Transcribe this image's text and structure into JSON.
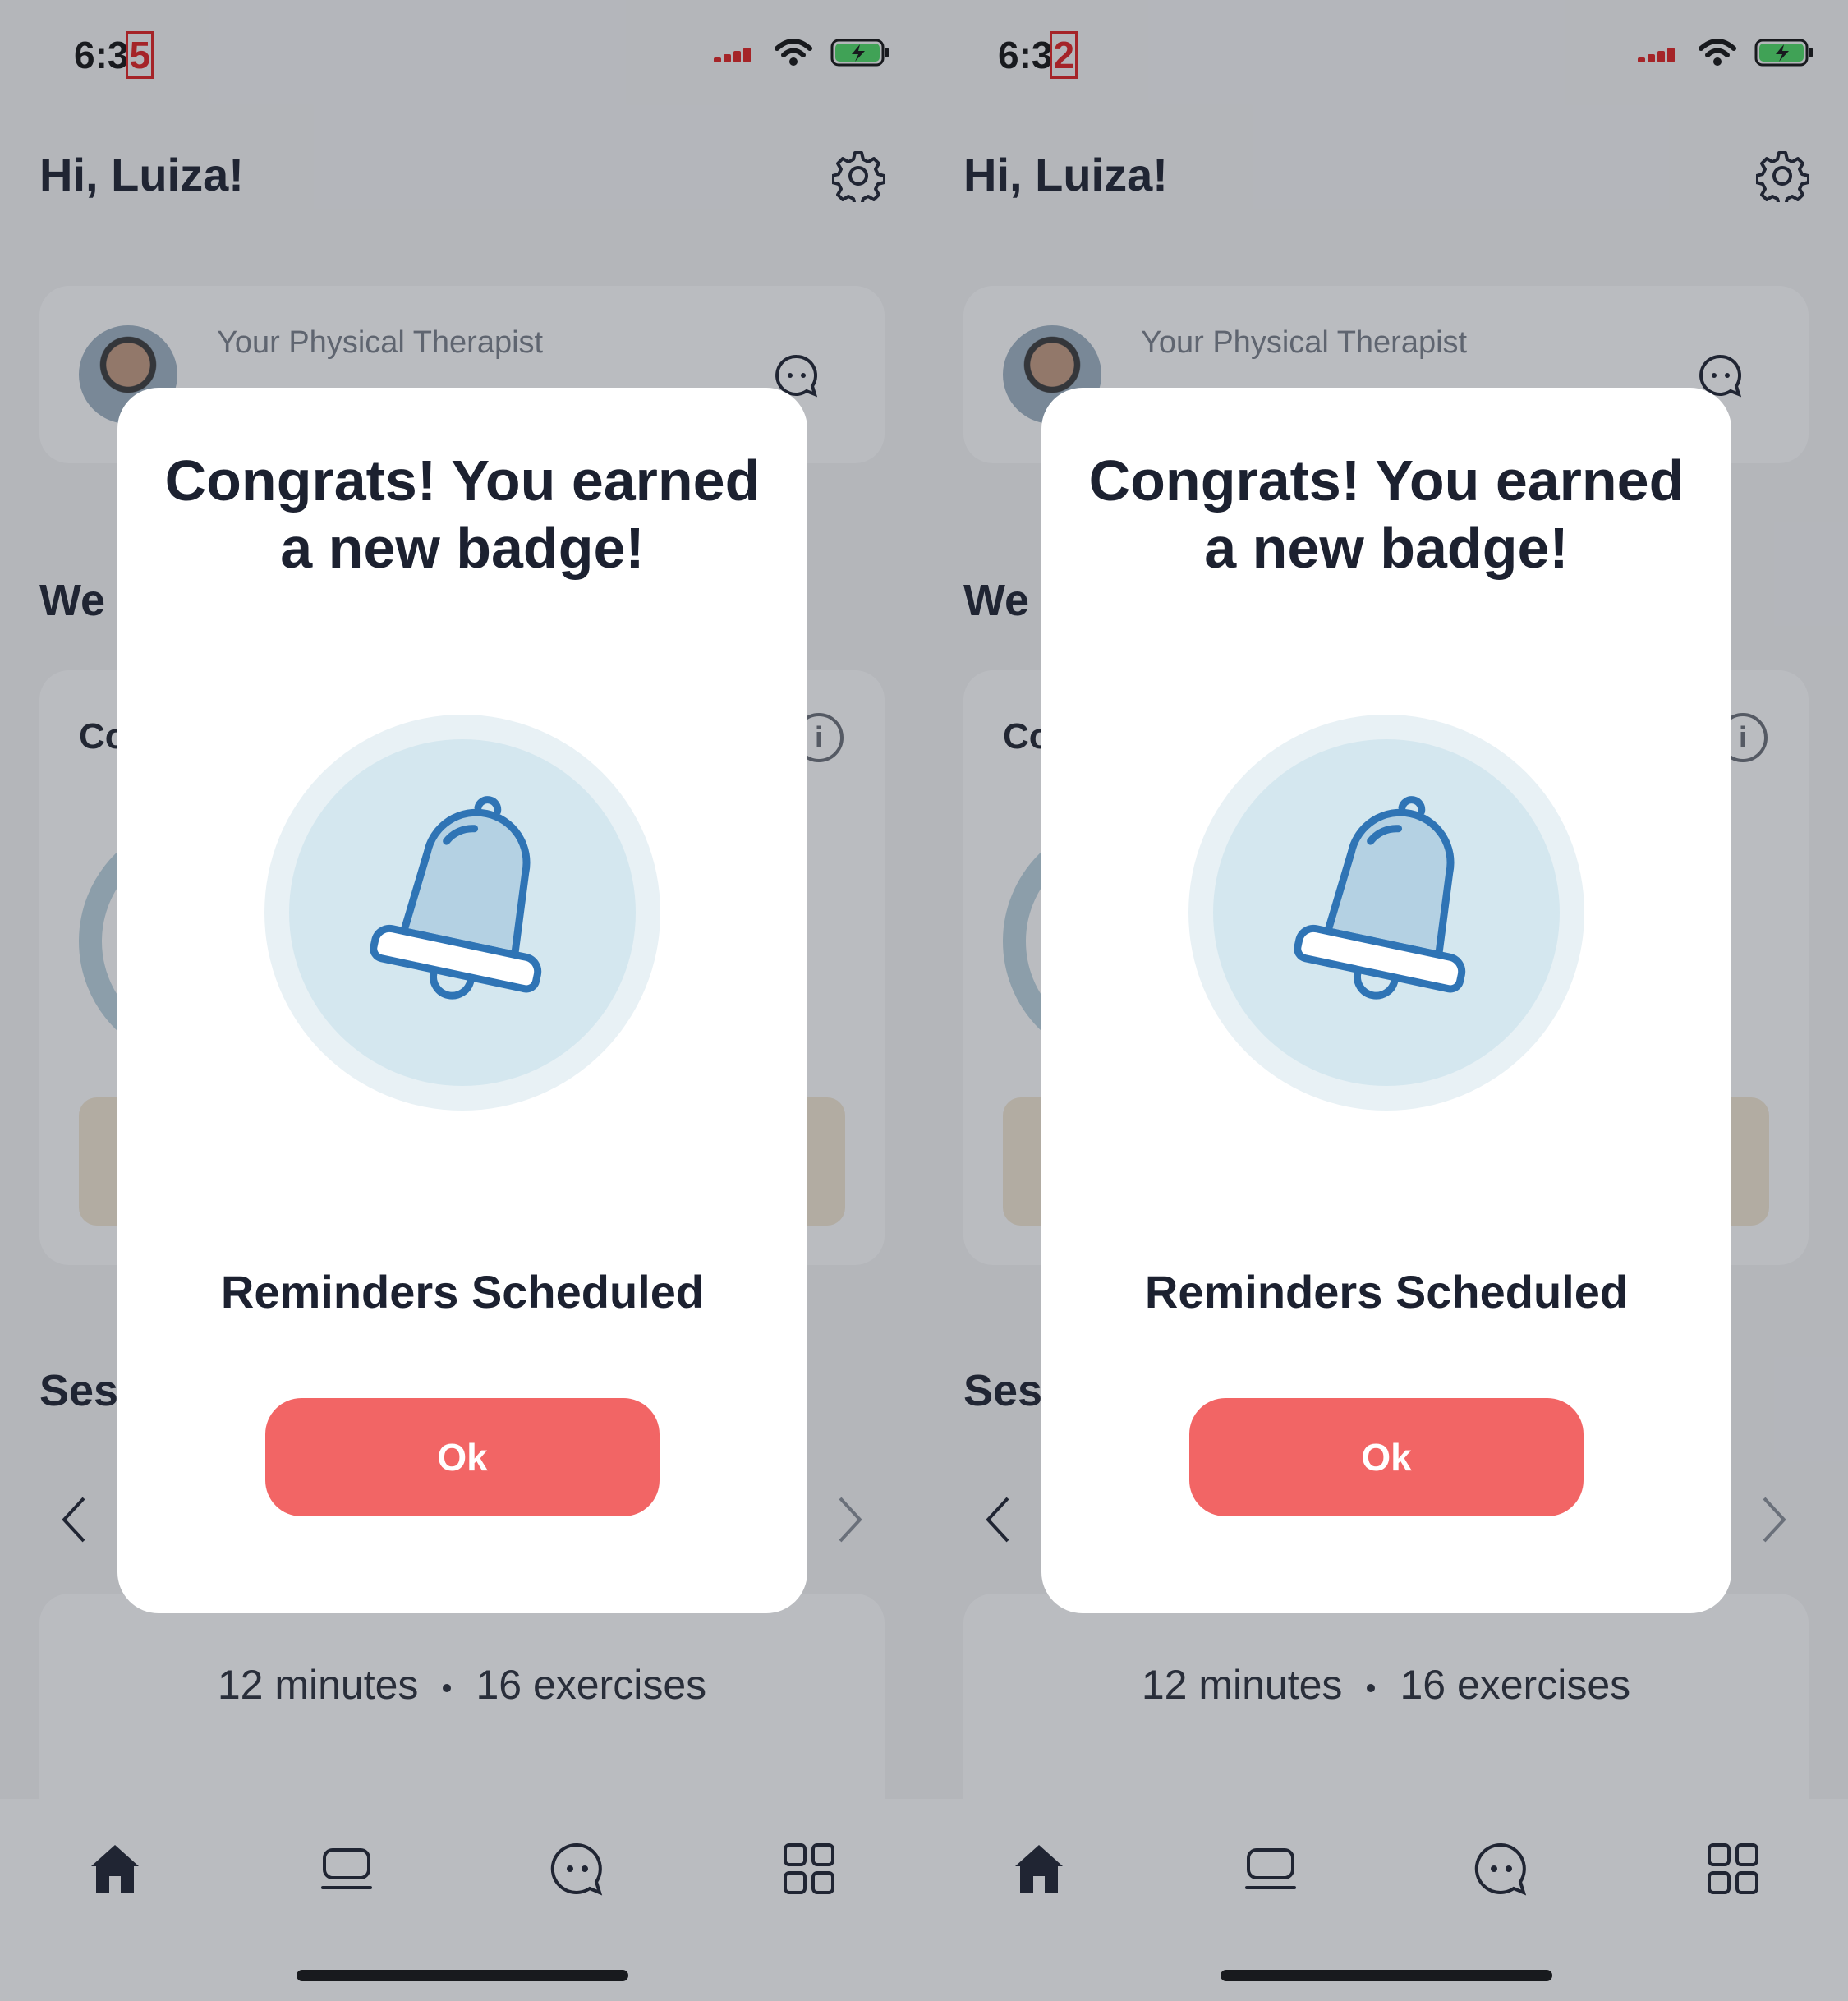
{
  "screens": [
    {
      "status": {
        "time_prefix": "6:3",
        "time_glitch": "5"
      },
      "header": {
        "greeting": "Hi, Luiza!"
      },
      "therapist": {
        "label": "Your Physical Therapist"
      },
      "weekly": {
        "title": "We",
        "card_label": "Co",
        "info_glyph": "i"
      },
      "sessions": {
        "title": "Ses",
        "duration": "12 minutes",
        "exercises": "16 exercises"
      },
      "modal": {
        "title": "Congrats! You earned a new badge!",
        "badge_name": "Reminders Scheduled",
        "ok_label": "Ok",
        "badge_icon": "bell-icon"
      }
    },
    {
      "status": {
        "time_prefix": "6:3",
        "time_glitch": "2"
      },
      "header": {
        "greeting": "Hi, Luiza!"
      },
      "therapist": {
        "label": "Your Physical Therapist"
      },
      "weekly": {
        "title": "We",
        "card_label": "Co",
        "info_glyph": "i"
      },
      "sessions": {
        "title": "Ses",
        "duration": "12 minutes",
        "exercises": "16 exercises"
      },
      "modal": {
        "title": "Congrats! You earned a new badge!",
        "badge_name": "Reminders Scheduled",
        "ok_label": "Ok",
        "badge_icon": "bell-icon"
      }
    }
  ],
  "colors": {
    "accent": "#f26565",
    "badge_outer": "#e8f1f5",
    "badge_inner": "#d4e7ef",
    "bell_stroke": "#2f74b5",
    "bell_fill": "#b4d1e3",
    "battery": "#4cd964"
  },
  "tabs": [
    "home-icon",
    "sessions-icon",
    "chat-icon",
    "grid-icon"
  ]
}
